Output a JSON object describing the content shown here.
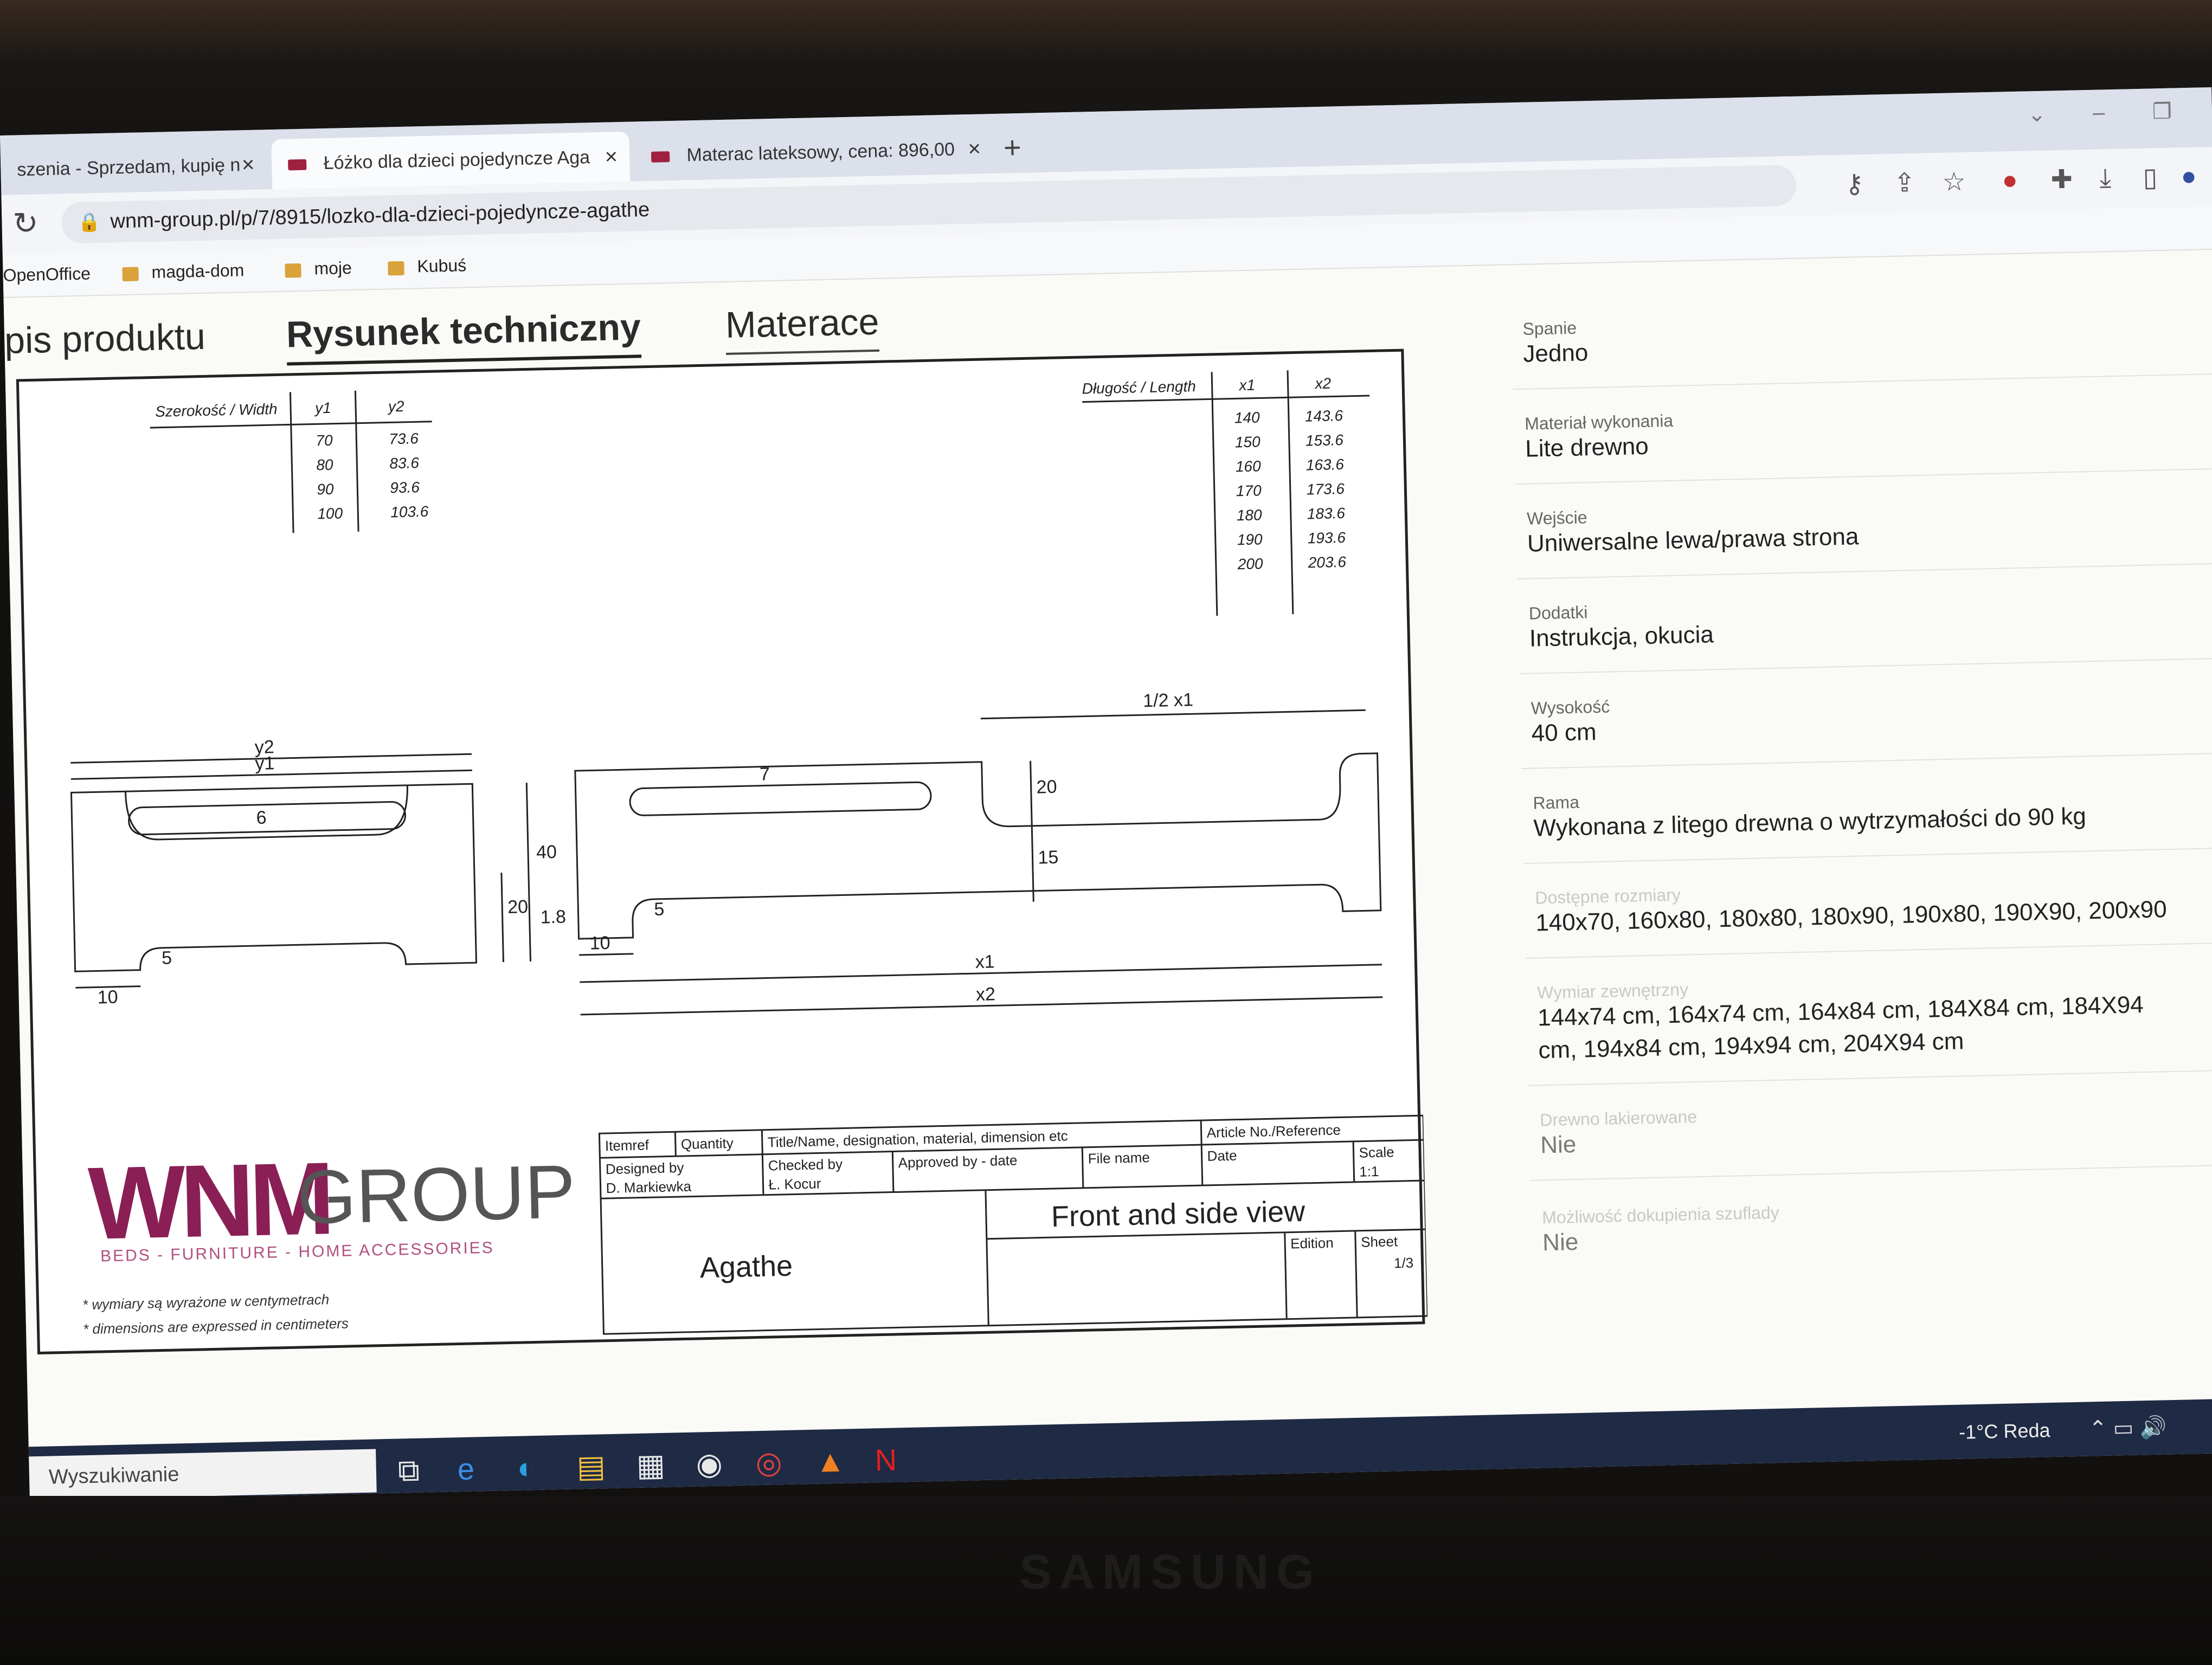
{
  "browser": {
    "tabs": [
      {
        "title": "szenia - Sprzedam, kupię n",
        "active": false
      },
      {
        "title": "Łóżko dla dzieci pojedyncze Aga",
        "active": true
      },
      {
        "title": "Materac lateksowy, cena: 896,00",
        "active": false
      }
    ],
    "new_tab": "+",
    "url": "wnm-group.pl/p/7/8915/lozko-dla-dzieci-pojedyncze-agathe",
    "bookmarks": [
      "OpenOffice",
      "magda-dom",
      "moje",
      "Kubuś"
    ]
  },
  "page": {
    "tabs": [
      "pis produktu",
      "Rysunek techniczny",
      "Materace"
    ],
    "active_tab": "Rysunek techniczny"
  },
  "drawing": {
    "width_table": {
      "header": [
        "Szerokość / Width",
        "y1",
        "y2"
      ],
      "rows": [
        [
          "70",
          "73.6"
        ],
        [
          "80",
          "83.6"
        ],
        [
          "90",
          "93.6"
        ],
        [
          "100",
          "103.6"
        ]
      ]
    },
    "length_table": {
      "header": [
        "Długość / Length",
        "x1",
        "x2"
      ],
      "rows": [
        [
          "140",
          "143.6"
        ],
        [
          "150",
          "153.6"
        ],
        [
          "160",
          "163.6"
        ],
        [
          "170",
          "173.6"
        ],
        [
          "180",
          "183.6"
        ],
        [
          "190",
          "193.6"
        ],
        [
          "200",
          "203.6"
        ]
      ]
    },
    "front_dims": {
      "y2": "y2",
      "y1": "y1",
      "slot": "6",
      "h40": "40",
      "h20": "20",
      "h5": "5",
      "w10": "10"
    },
    "side_dims": {
      "half": "1/2 x1",
      "slot": "7",
      "h20": "20",
      "h15": "15",
      "h5": "5",
      "w10": "10",
      "t18": "1.8",
      "x1": "x1",
      "x2": "x2"
    },
    "logo_main": "WNM",
    "logo_group": "GROUP",
    "logo_sub": "BEDS - FURNITURE - HOME ACCESSORIES",
    "notes": [
      "* wymiary są wyrażone w centymetrach",
      "* dimensions are expressed in centimeters"
    ],
    "title_block": {
      "itemref": "Itemref",
      "quantity": "Quantity",
      "title_name": "Title/Name, designation, material, dimension etc",
      "article": "Article No./Reference",
      "designed_by": "Designed by",
      "designer": "D. Markiewka",
      "checked_by": "Checked by",
      "checker": "Ł. Kocur",
      "approved": "Approved by - date",
      "file_name": "File name",
      "date": "Date",
      "scale": "Scale",
      "scale_value": "1:1",
      "product": "Agathe",
      "view": "Front and side view",
      "edition": "Edition",
      "sheet": "Sheet",
      "sheet_value": "1/3"
    }
  },
  "specs": [
    {
      "label": "Spanie",
      "value": "Jedno"
    },
    {
      "label": "Materiał wykonania",
      "value": "Lite drewno"
    },
    {
      "label": "Wejście",
      "value": "Uniwersalne lewa/prawa strona"
    },
    {
      "label": "Dodatki",
      "value": "Instrukcja, okucia"
    },
    {
      "label": "Wysokość",
      "value": "40 cm"
    },
    {
      "label": "Rama",
      "value": "Wykonana z litego drewna o wytrzymałości do 90 kg"
    },
    {
      "label": "Dostępne rozmiary",
      "value": "140x70, 160x80, 180x80, 180x90, 190x80, 190X90, 200x90"
    },
    {
      "label": "Wymiar zewnętrzny",
      "value": "144x74 cm, 164x74 cm, 164x84 cm, 184X84 cm, 184X94",
      "value2": "cm, 194x84 cm, 194x94 cm, 204X94 cm"
    },
    {
      "label": "Drewno lakierowane",
      "value": "Nie"
    },
    {
      "label": "Możliwość dokupienia szuflady",
      "value": "Nie"
    }
  ],
  "taskbar": {
    "search": "Wyszukiwanie",
    "temp": "-1°C",
    "location": "Reda"
  },
  "monitor_brand": "SAMSUNG"
}
